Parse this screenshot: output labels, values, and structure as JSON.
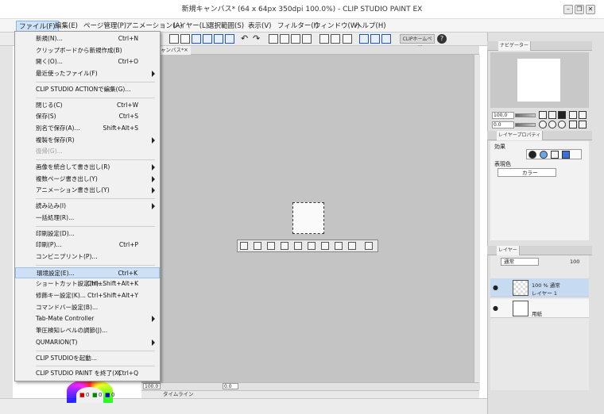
{
  "window": {
    "title": "新規キャンバス* (64 x 64px 350dpi 100.0%) - CLIP STUDIO PAINT EX",
    "minimize": "–",
    "restore": "❐",
    "close": "✕"
  },
  "menubar": [
    "ファイル(F)",
    "編集(E)",
    "ページ管理(P)",
    "アニメーション(A)",
    "レイヤー(L)",
    "選択範囲(S)",
    "表示(V)",
    "フィルター(I)",
    "ウィンドウ(W)",
    "ヘルプ(H)"
  ],
  "toolbar": {
    "clip_home": "CLIPホームページ",
    "help": "?"
  },
  "document_tab": {
    "label": "ャンバス*",
    "close": "×"
  },
  "file_menu": [
    {
      "label": "新規(N)...",
      "shortcut": "Ctrl+N"
    },
    {
      "label": "クリップボードから新規作成(B)",
      "shortcut": ""
    },
    {
      "label": "開く(O)...",
      "shortcut": "Ctrl+O"
    },
    {
      "label": "最近使ったファイル(F)",
      "shortcut": "",
      "submenu": true
    },
    {
      "separator": true
    },
    {
      "label": "CLIP STUDIO ACTIONで編集(G)...",
      "shortcut": ""
    },
    {
      "separator": true
    },
    {
      "label": "閉じる(C)",
      "shortcut": "Ctrl+W"
    },
    {
      "label": "保存(S)",
      "shortcut": "Ctrl+S"
    },
    {
      "label": "別名で保存(A)...",
      "shortcut": "Shift+Alt+S"
    },
    {
      "label": "複製を保存(R)",
      "shortcut": "",
      "submenu": true
    },
    {
      "label": "復帰(G)...",
      "shortcut": "",
      "disabled": true
    },
    {
      "separator": true
    },
    {
      "label": "画像を統合して書き出し(R)",
      "shortcut": "",
      "submenu": true
    },
    {
      "label": "複数ページ書き出し(Y)",
      "shortcut": "",
      "submenu": true
    },
    {
      "label": "アニメーション書き出し(Y)",
      "shortcut": "",
      "submenu": true
    },
    {
      "separator": true
    },
    {
      "label": "読み込み(I)",
      "shortcut": "",
      "submenu": true
    },
    {
      "label": "一括処理(R)...",
      "shortcut": ""
    },
    {
      "separator": true
    },
    {
      "label": "印刷設定(D)...",
      "shortcut": ""
    },
    {
      "label": "印刷(P)...",
      "shortcut": "Ctrl+P"
    },
    {
      "label": "コンビニプリント(P)...",
      "shortcut": ""
    },
    {
      "separator": true
    },
    {
      "label": "環境設定(E)...",
      "shortcut": "Ctrl+K",
      "hover": true
    },
    {
      "label": "ショートカット設定(H)...",
      "shortcut": "Ctrl+Shift+Alt+K"
    },
    {
      "label": "修飾キー設定(K)...",
      "shortcut": "Ctrl+Shift+Alt+Y"
    },
    {
      "label": "コマンドバー設定(B)...",
      "shortcut": ""
    },
    {
      "label": "Tab-Mate Controller",
      "shortcut": "",
      "submenu": true
    },
    {
      "label": "筆圧検知レベルの調節(J)...",
      "shortcut": ""
    },
    {
      "label": "QUMARION(T)",
      "shortcut": "",
      "submenu": true
    },
    {
      "separator": true
    },
    {
      "label": "CLIP STUDIOを起動...",
      "shortcut": ""
    },
    {
      "separator": true
    },
    {
      "label": "CLIP STUDIO PAINT を終了(X)",
      "shortcut": "Ctrl+Q"
    }
  ],
  "navigator": {
    "tab": "ナビゲーター",
    "zoom": "100.0",
    "angle": "0.0"
  },
  "layer_property": {
    "tab": "レイヤープロパティ",
    "effect_label": "効果",
    "expression_color_label": "表現色",
    "expression_color_value": "カラー"
  },
  "layer_panel": {
    "tab": "レイヤー",
    "blend_mode": "通常",
    "opacity": "100",
    "layers": [
      {
        "line1": "100 % 通常",
        "line2": "レイヤー 1",
        "selected": true
      },
      {
        "line1": "",
        "line2": "用紙",
        "selected": false
      }
    ]
  },
  "status": {
    "zoom": "100.0",
    "angle": "0.0",
    "timeline": "タイムライン"
  },
  "color": {
    "r": "0",
    "g": "0",
    "b": "0"
  }
}
